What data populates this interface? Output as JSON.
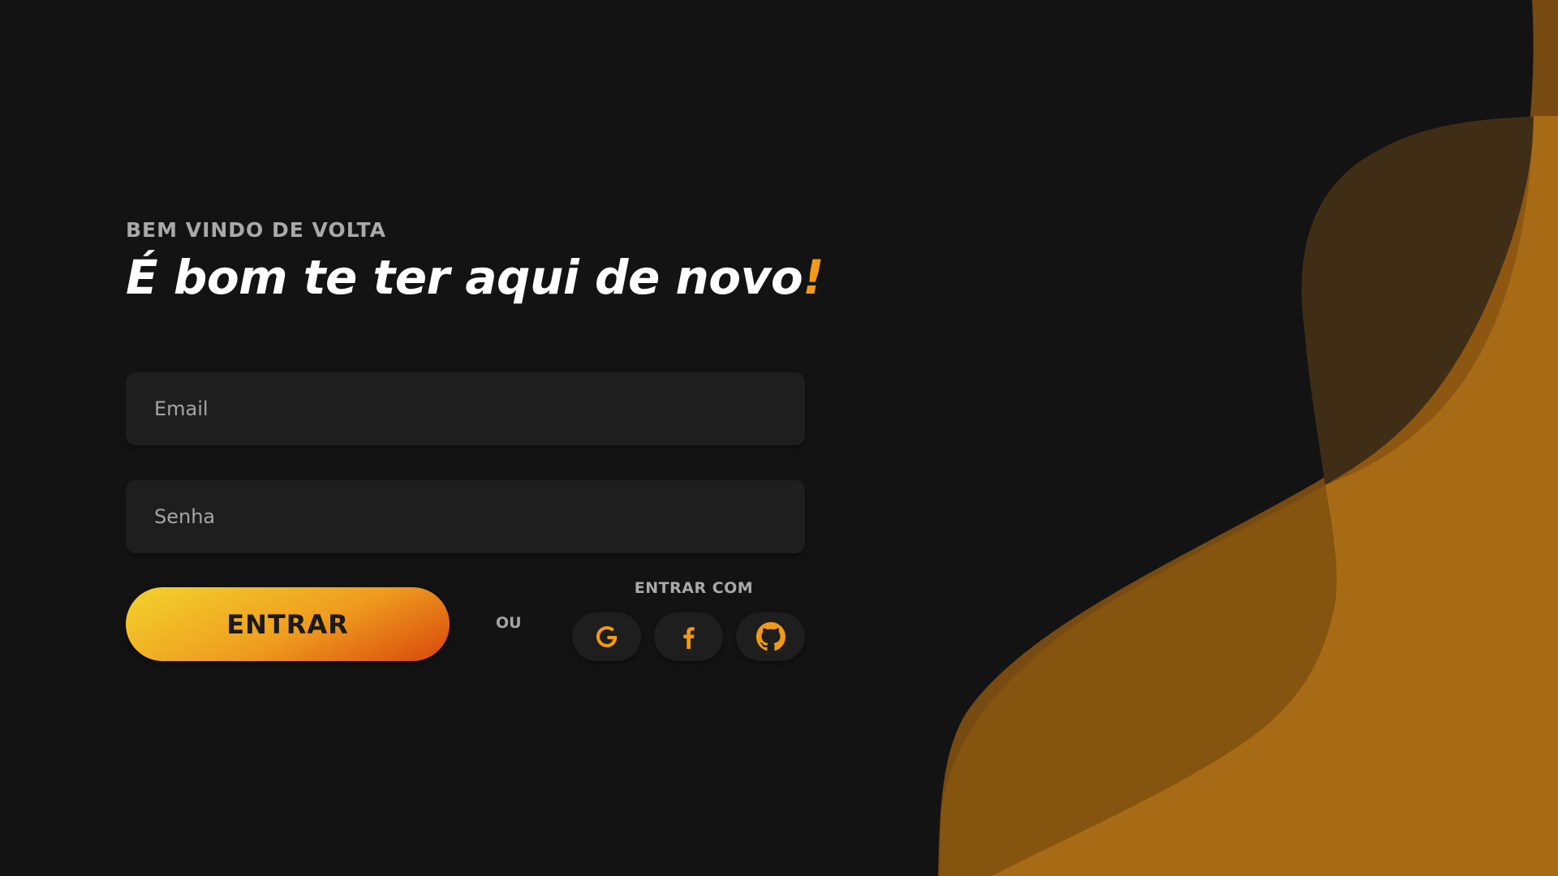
{
  "header": {
    "eyebrow": "BEM VINDO DE VOLTA",
    "headline": "É bom te ter aqui de novo",
    "headline_accent": "!"
  },
  "form": {
    "email_placeholder": "Email",
    "password_placeholder": "Senha",
    "submit_label": "ENTRAR",
    "separator": "OU",
    "social_label": "ENTRAR COM",
    "social_providers": [
      {
        "name": "Google",
        "icon": "google-icon"
      },
      {
        "name": "Facebook",
        "icon": "facebook-icon"
      },
      {
        "name": "GitHub",
        "icon": "github-icon"
      }
    ]
  },
  "colors": {
    "background": "#131313",
    "accent": "#f39a14",
    "input_bg": "#1e1e1e",
    "button_gradient": [
      "#f3d32c",
      "#ef9c1f",
      "#d8470b"
    ],
    "wave_light": "#9e6514",
    "wave_dark": "#3f2d15"
  }
}
